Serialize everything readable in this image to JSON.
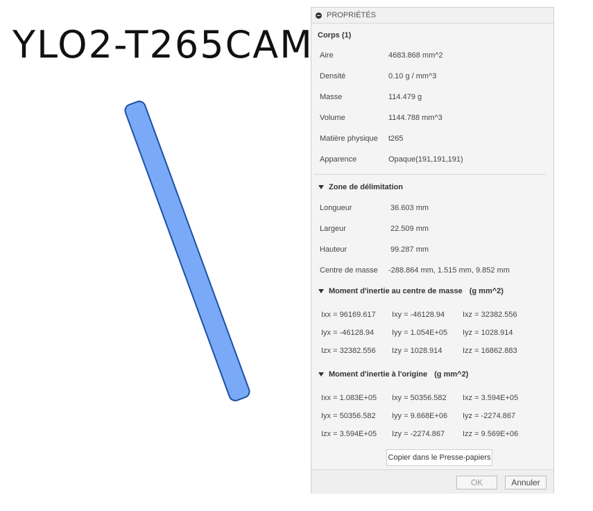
{
  "viewport": {
    "part_name": "YLO2-T265CAM"
  },
  "panel": {
    "header": "PROPRIÉTÉS",
    "body_title": "Corps (1)",
    "general": [
      {
        "label": "Aire",
        "value": "4683.868 mm^2"
      },
      {
        "label": "Densité",
        "value": "0.10 g / mm^3"
      },
      {
        "label": "Masse",
        "value": "114.479 g"
      },
      {
        "label": "Volume",
        "value": "1144.788 mm^3"
      },
      {
        "label": "Matière physique",
        "value": "t265"
      },
      {
        "label": "Apparence",
        "value": "Opaque(191,191,191)"
      }
    ],
    "bbox": {
      "title": "Zone de délimitation",
      "rows": [
        {
          "label": "Longueur",
          "value": "36.603 mm"
        },
        {
          "label": "Largeur",
          "value": "22.509 mm"
        },
        {
          "label": "Hauteur",
          "value": "99.287 mm"
        },
        {
          "label": "Centre de masse",
          "value": "-288.864 mm, 1.515 mm, 9.852 mm"
        }
      ]
    },
    "inertia_cm": {
      "title": "Moment d'inertie au centre de masse",
      "units": "(g mm^2)",
      "grid": [
        [
          "Ixx = 96169.617",
          "Ixy = -46128.94",
          "Ixz = 32382.556"
        ],
        [
          "Iyx = -46128.94",
          "Iyy = 1.054E+05",
          "Iyz = 1028.914"
        ],
        [
          "Izx = 32382.556",
          "Izy = 1028.914",
          "Izz = 16862.883"
        ]
      ]
    },
    "inertia_origin": {
      "title": "Moment d'inertie à l'origine",
      "units": "(g mm^2)",
      "grid": [
        [
          "Ixx = 1.083E+05",
          "Ixy = 50356.582",
          "Ixz = 3.594E+05"
        ],
        [
          "Iyx = 50356.582",
          "Iyy = 9.668E+06",
          "Iyz = -2274.867"
        ],
        [
          "Izx = 3.594E+05",
          "Izy = -2274.867",
          "Izz = 9.569E+06"
        ]
      ]
    },
    "copy_label": "Copier dans le Presse-papiers",
    "ok_label": "OK",
    "cancel_label": "Annuler"
  },
  "colors": {
    "part_fill": "#7aaaf7",
    "part_edge": "#1c4fa3"
  }
}
